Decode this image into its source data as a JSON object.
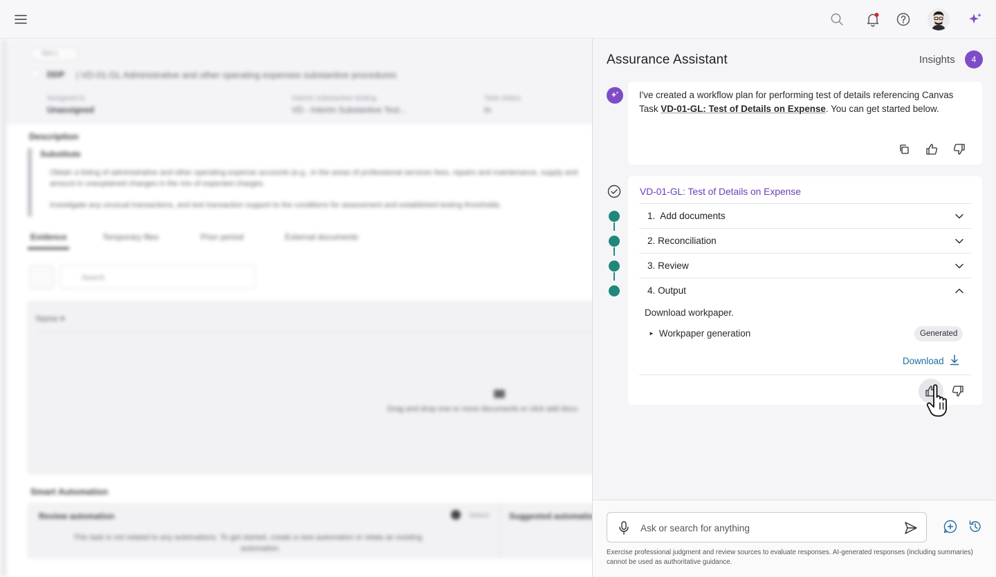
{
  "panel": {
    "title": "Assurance Assistant",
    "insights_label": "Insights",
    "insights_count": "4"
  },
  "message": {
    "text_before": "I've created a workflow plan for performing test of details referencing Canvas Task ",
    "task_link": "VD-01-GL: Test of Details on Expense",
    "text_after": ". You can get started below."
  },
  "workflow": {
    "title": "VD-01-GL: Test of Details on Expense",
    "steps": [
      {
        "label": "1.  Add documents",
        "expanded": false
      },
      {
        "label": "2. Reconciliation",
        "expanded": false
      },
      {
        "label": "3. Review",
        "expanded": false
      },
      {
        "label": "4. Output",
        "expanded": true
      }
    ],
    "output": {
      "description": "Download workpaper.",
      "item_label": "Workpaper generation",
      "status_badge": "Generated",
      "download_label": "Download"
    }
  },
  "input": {
    "placeholder": "Ask or search for anything"
  },
  "disclaimer": "Exercise professional judgment and review sources to evaluate responses. AI-generated responses (including summaries) cannot be used as authoritative guidance.",
  "colors": {
    "accent_purple": "#7d4cc6",
    "workflow_green": "#1f877c",
    "link_blue": "#1f6c9c",
    "notification_dot": "#d9232e"
  },
  "icons": [
    "menu-icon",
    "search-icon",
    "bell-icon",
    "help-icon",
    "sparkle-icon",
    "copy-icon",
    "thumbs-up-icon",
    "thumbs-down-icon",
    "check-circle-icon",
    "chevron-down-icon",
    "chevron-up-icon",
    "download-icon",
    "mic-icon",
    "send-icon",
    "new-chat-icon",
    "history-icon"
  ]
}
